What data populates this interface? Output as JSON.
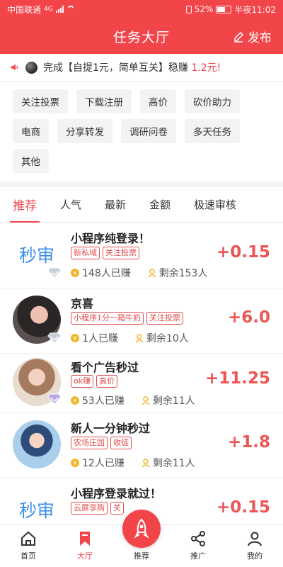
{
  "status_bar": {
    "carrier": "中国联通",
    "network": "4G",
    "battery": "52%",
    "time": "半夜11:02"
  },
  "header": {
    "title": "任务大厅",
    "publish_label": "发布"
  },
  "notice": {
    "text_before": "完成【自提1元，简单互关】稳赚",
    "amount": "1.2元",
    "suffix": "!"
  },
  "categories": [
    "关注投票",
    "下载注册",
    "高价",
    "砍价助力",
    "电商",
    "分享转发",
    "调研问卷",
    "多天任务",
    "其他"
  ],
  "tabs": {
    "active": 0,
    "items": [
      "推荐",
      "人气",
      "最新",
      "金额",
      "极速审核"
    ]
  },
  "tasks": [
    {
      "avatar_text": "秒审",
      "title": "小程序纯登录！",
      "tags": [
        "新私域",
        "关注投票"
      ],
      "earned": "148人已赚",
      "remaining": "剩余153人",
      "reward": "+0.15"
    },
    {
      "avatar_text": "",
      "title": "京喜",
      "tags": [
        "小程序1分一箱牛奶",
        "关注投票"
      ],
      "earned": "1人已赚",
      "remaining": "剩余10人",
      "reward": "+6.0"
    },
    {
      "avatar_text": "",
      "title": "看个广告秒过",
      "tags": [
        "ok赚",
        "高价"
      ],
      "earned": "53人已赚",
      "remaining": "剩余11人",
      "reward": "+11.25"
    },
    {
      "avatar_text": "",
      "title": "新人一分钟秒过",
      "tags": [
        "农场庄园",
        "收徒"
      ],
      "earned": "12人已赚",
      "remaining": "剩余11人",
      "reward": "+1.8"
    },
    {
      "avatar_text": "秒审",
      "title": "小程序登录就过！",
      "tags": [
        "云屏享购",
        "关"
      ],
      "earned": "",
      "remaining": "",
      "reward": "+0.15"
    }
  ],
  "bottom_nav": [
    {
      "label": "首页",
      "icon": "home-icon"
    },
    {
      "label": "大厅",
      "icon": "bookmark-icon"
    },
    {
      "label": "推荐",
      "icon": "rocket-icon"
    },
    {
      "label": "推广",
      "icon": "share-icon"
    },
    {
      "label": "我的",
      "icon": "user-icon"
    }
  ],
  "colors": {
    "brand": "#f2454a",
    "reward": "#ee5555",
    "badge_blue": "#3b8ee8"
  }
}
